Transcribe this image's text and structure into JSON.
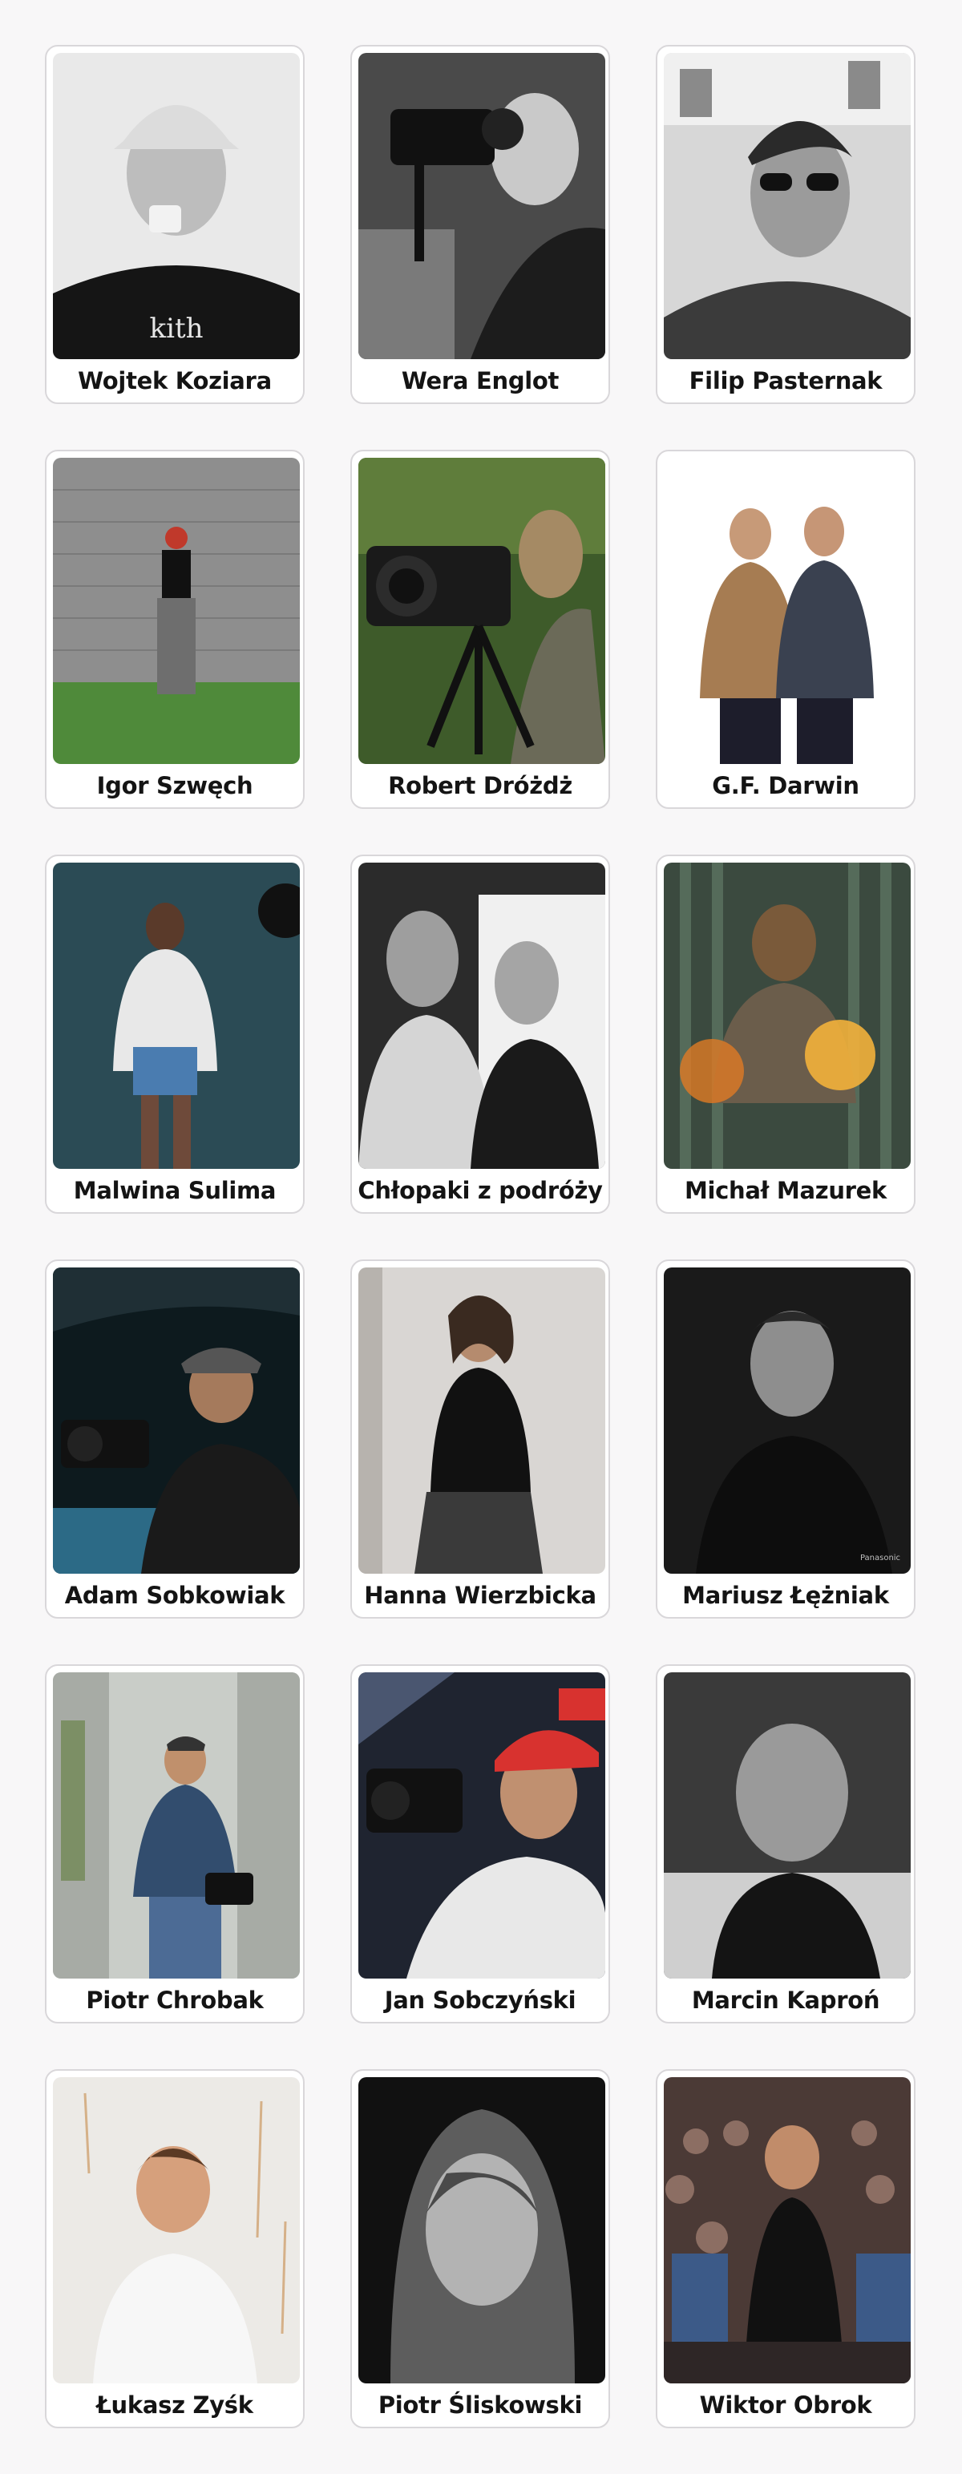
{
  "people": [
    {
      "name": "Wojtek Koziara",
      "photo": "portrait-photo-bw",
      "icon": "cap-coffee-portrait-icon"
    },
    {
      "name": "Wera Englot",
      "photo": "camera-operator-photo-bw",
      "icon": "cinema-camera-icon"
    },
    {
      "name": "Filip Pasternak",
      "photo": "portrait-photo-bw",
      "icon": "sunglasses-portrait-icon"
    },
    {
      "name": "Igor Szwęch",
      "photo": "brick-wall-photo",
      "icon": "standing-person-icon"
    },
    {
      "name": "Robert Dróżdż",
      "photo": "camera-operator-photo",
      "icon": "tripod-camera-icon"
    },
    {
      "name": "G.F. Darwin",
      "photo": "duo-photo-white-bg",
      "icon": "two-men-icon"
    },
    {
      "name": "Malwina Sulima",
      "photo": "studio-portrait-photo",
      "icon": "standing-woman-icon"
    },
    {
      "name": "Chłopaki z podróży",
      "photo": "duo-photo-bw",
      "icon": "two-men-icon"
    },
    {
      "name": "Michał Mazurek",
      "photo": "bokeh-portrait-photo",
      "icon": "seated-man-icon"
    },
    {
      "name": "Adam Sobkowiak",
      "photo": "car-window-photo",
      "icon": "camera-man-icon"
    },
    {
      "name": "Hanna Wierzbicka",
      "photo": "interior-portrait-photo",
      "icon": "standing-woman-icon"
    },
    {
      "name": "Mariusz Łężniak",
      "photo": "dark-portrait-photo",
      "icon": "man-portrait-icon"
    },
    {
      "name": "Piotr Chrobak",
      "photo": "outdoor-camera-photo",
      "icon": "camera-man-icon"
    },
    {
      "name": "Jan Sobczyński",
      "photo": "smiling-camera-photo",
      "icon": "camera-man-icon"
    },
    {
      "name": "Marcin Kaproń",
      "photo": "sky-portrait-photo-bw",
      "icon": "man-portrait-icon"
    },
    {
      "name": "Łukasz Zyśk",
      "photo": "white-wall-portrait-photo",
      "icon": "smiling-man-icon"
    },
    {
      "name": "Piotr Śliskowski",
      "photo": "long-hair-portrait-photo-bw",
      "icon": "man-portrait-icon"
    },
    {
      "name": "Wiktor Obrok",
      "photo": "audience-photo",
      "icon": "speaker-icon"
    }
  ],
  "palette": {
    "card_border": "#d9d7da",
    "card_bg": "#ffffff",
    "page_bg": "#f8f7f8",
    "text": "#141414"
  }
}
